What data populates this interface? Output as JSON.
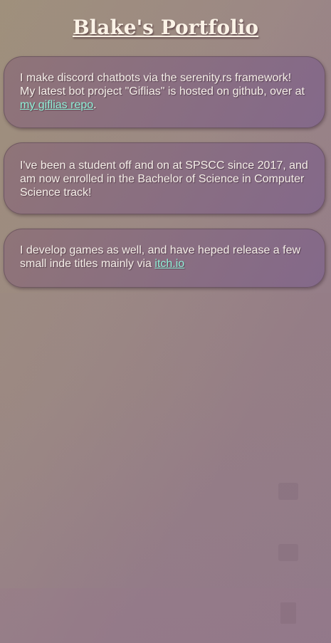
{
  "page": {
    "title": "Blake's Portfolio"
  },
  "cards": [
    {
      "text_before": "I make discord chatbots via the serenity.rs framework! My latest bot project \"Giflias\" is hosted on github, over at ",
      "link_text": "my giflias repo",
      "text_after": "."
    },
    {
      "text": "I've been a student off and on at SPSCC since 2017, and am now enrolled in the Bachelor of Science in Computer Science track!"
    },
    {
      "text_before": "I develop games as well, and have heped release a few small inde titles mainly via ",
      "link_text": "itch.io",
      "text_after": ""
    }
  ],
  "colors": {
    "link": "#8ff0d8",
    "card_bg": "#8a6f82",
    "title": "#fbf3e7"
  }
}
